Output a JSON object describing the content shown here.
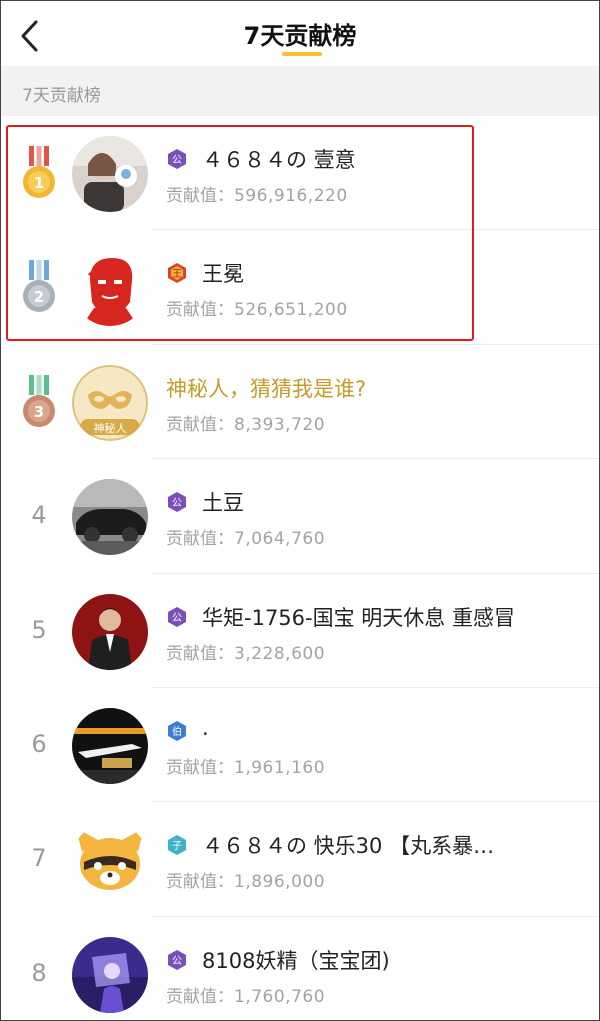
{
  "header": {
    "title": "7天贡献榜",
    "back_icon": "chevron-left-icon",
    "underline_color": "#f6c12a"
  },
  "section": {
    "label": "7天贡献榜"
  },
  "contribution_label": "贡献值：",
  "highlight_color": "#e21d1d",
  "rows": [
    {
      "rank": "1",
      "medal": "gold-medal-icon",
      "badge": "公",
      "badge_color": "#7b4fb8",
      "name": "４６８４の 壹意",
      "value": "596,916,220"
    },
    {
      "rank": "2",
      "medal": "silver-medal-icon",
      "badge": "王",
      "badge_color": "#d6452c",
      "name": "王冕",
      "value": "526,651,200"
    },
    {
      "rank": "3",
      "medal": "bronze-medal-icon",
      "name": "神秘人，猜猜我是谁?",
      "avatar_text": "神秘人",
      "value": "8,393,720"
    },
    {
      "rank": "4",
      "badge": "公",
      "badge_color": "#7b4fb8",
      "name": "土豆",
      "value": "7,064,760"
    },
    {
      "rank": "5",
      "badge": "公",
      "badge_color": "#7b4fb8",
      "name": "华矩-1756-国宝 明天休息 重感冒",
      "value": "3,228,600"
    },
    {
      "rank": "6",
      "badge": "伯",
      "badge_color": "#3b7fd4",
      "name": ".",
      "value": "1,961,160"
    },
    {
      "rank": "7",
      "badge": "子",
      "badge_color": "#3fb2c6",
      "name": "４６８４の 快乐30 【丸系暴…",
      "value": "1,896,000"
    },
    {
      "rank": "8",
      "badge": "公",
      "badge_color": "#7b4fb8",
      "name": "8108妖精（宝宝团)",
      "value": "1,760,760"
    }
  ]
}
